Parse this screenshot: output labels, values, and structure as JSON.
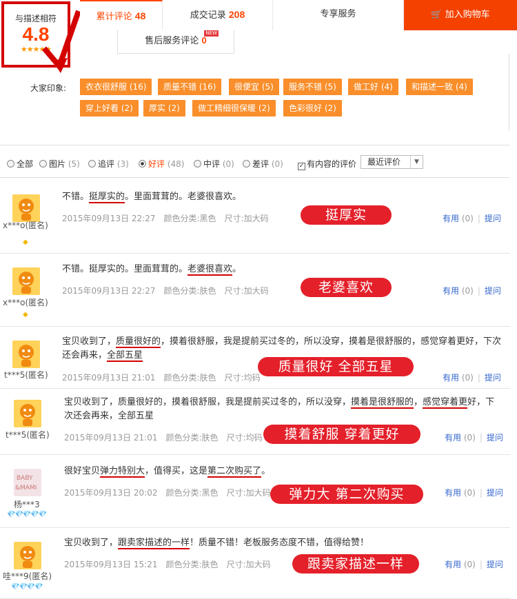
{
  "score": {
    "label": "与描述相符",
    "value": "4.8",
    "stars": "★★★★★"
  },
  "tabs": [
    {
      "label": "累计评论",
      "count": "48"
    },
    {
      "label": "成交记录",
      "count": "208"
    },
    {
      "label": "专享服务",
      "count": ""
    }
  ],
  "cart_label": "加入购物车",
  "subtab": {
    "label": "售后服务评论",
    "count": "0",
    "badge": "NEW"
  },
  "impressions": {
    "label": "大家印象:",
    "tags": [
      "衣衣很舒服 (16)",
      "质量不错 (16)",
      "很便宜 (5)",
      "服务不错 (5)",
      "做工好 (4)",
      "和描述一致 (4)",
      "穿上好看 (2)",
      "厚实 (2)",
      "做工精细很保暖 (2)",
      "色彩很好 (2)"
    ]
  },
  "filter": {
    "options": [
      {
        "label": "全部",
        "count": ""
      },
      {
        "label": "图片",
        "count": "(5)"
      },
      {
        "label": "追评",
        "count": "(3)"
      },
      {
        "label": "好评",
        "count": "(48)"
      },
      {
        "label": "中评",
        "count": "(0)"
      },
      {
        "label": "差评",
        "count": "(0)"
      }
    ],
    "content_only_label": "有内容的评价",
    "sort_value": "最近评价"
  },
  "useful_label": "有用",
  "useful_count": "(0)",
  "reply_label": "提问",
  "reviews": [
    {
      "user": "x***o(匿名)",
      "badge": "◆",
      "text_parts": [
        "不错。",
        "挺厚实的",
        "。里面茸茸的。老婆很喜欢。"
      ],
      "date": "2015年09月13日 22:27",
      "color": "颜色分类:黑色",
      "size": "尺寸:加大码",
      "callout": "挺厚实"
    },
    {
      "user": "x***o(匿名)",
      "badge": "◆",
      "text_parts": [
        "不错。挺厚实的。里面茸茸的。",
        "老婆很喜欢",
        "。"
      ],
      "date": "2015年09月13日 22:27",
      "color": "颜色分类:肤色",
      "size": "尺寸:加大码",
      "callout": "老婆喜欢"
    },
    {
      "user": "t***5(匿名)",
      "badge": "",
      "text_parts": [
        "宝贝收到了，",
        "质量很好的",
        "，摸着很舒服，我是提前买过冬的，所以没穿，摸着是很舒服的，感觉穿着更好，下次还会再来，",
        "全部五星",
        ""
      ],
      "date": "2015年09月13日 21:01",
      "color": "颜色分类:肤色",
      "size": "尺寸:均码",
      "callout": "质量很好  全部五星"
    },
    {
      "user": "t***5(匿名)",
      "badge": "",
      "text_parts": [
        "宝贝收到了，质量很好的，摸着很舒服，我是提前买过冬的，所以没穿，",
        "摸着是很舒服的",
        "，",
        "感觉穿着更",
        "好，下次还会再来，全部五星"
      ],
      "date": "2015年09月13日 21:01",
      "color": "颜色分类:肤色",
      "size": "尺寸:均码",
      "callout": "摸着舒服  穿着更好"
    },
    {
      "user": "杨***3",
      "badge": "💎💎💎💎💎",
      "text_parts": [
        "很好宝贝",
        "弹力特别大",
        "，值得买，这是",
        "第二次购买了",
        "。"
      ],
      "date": "2015年09月13日 20:02",
      "color": "颜色分类:黑色",
      "size": "尺寸:加大码",
      "callout": "弹力大  第二次购买"
    },
    {
      "user": "哇***9(匿名)",
      "badge": "💎💎💎💎",
      "text_parts": [
        "宝贝收到了，",
        "跟卖家描述的一样",
        "！质量不错！老板服务态度不错，值得给赞！"
      ],
      "date": "2015年09月13日 15:21",
      "color": "颜色分类:肤色",
      "size": "尺寸:加大码",
      "callout": "跟卖家描述一样"
    }
  ]
}
